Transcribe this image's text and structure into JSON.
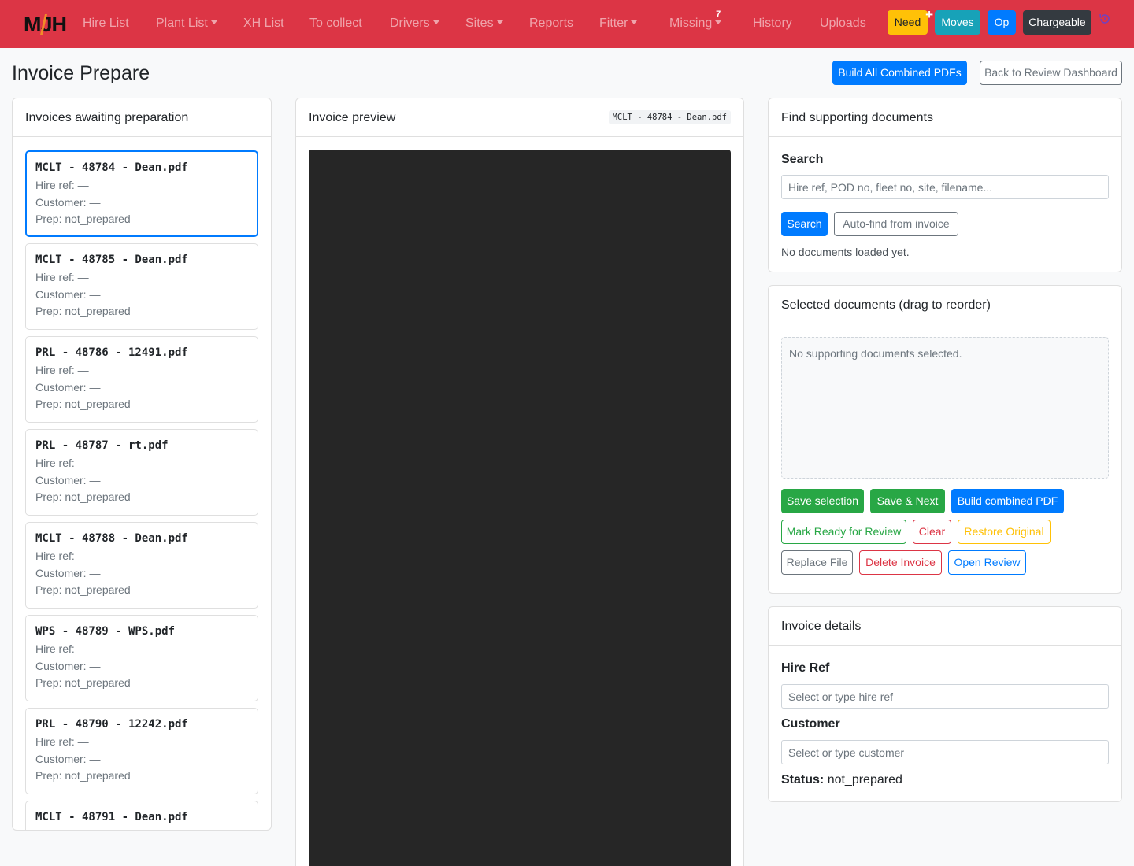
{
  "app": {
    "logo_text": "MJH",
    "nav_items": [
      {
        "label": "Hire List",
        "dropdown": false
      },
      {
        "label": "Plant List",
        "dropdown": true
      },
      {
        "label": "XH List",
        "dropdown": false
      },
      {
        "label": "To collect",
        "dropdown": false
      },
      {
        "label": "Drivers",
        "dropdown": true
      },
      {
        "label": "Sites",
        "dropdown": true
      },
      {
        "label": "Reports",
        "dropdown": false
      },
      {
        "label": "Fitter",
        "dropdown": true
      },
      {
        "label": "Missing",
        "dropdown": true,
        "badge": "7"
      },
      {
        "label": "History",
        "dropdown": false
      },
      {
        "label": "Uploads",
        "dropdown": false
      }
    ],
    "nav_buttons": {
      "need": {
        "label": "Need",
        "color": "#ffc107",
        "marker": "+"
      },
      "moves": {
        "label": "Moves",
        "color": "#17a2b8"
      },
      "op": {
        "label": "Op",
        "color": "#007bff"
      },
      "chargeable": {
        "label": "Chargeable",
        "color": "#343a40"
      }
    },
    "history_icon": "history-icon"
  },
  "page": {
    "title": "Invoice Prepare",
    "build_all_label": "Build All Combined PDFs",
    "back_label": "Back to Review Dashboard"
  },
  "invoices": {
    "header": "Invoices awaiting preparation",
    "hire_ref_label": "Hire ref: —",
    "customer_label": "Customer: —",
    "items": [
      {
        "name": "MCLT - 48784 - Dean.pdf",
        "prep": "Prep: not_prepared",
        "active": true
      },
      {
        "name": "MCLT - 48785 - Dean.pdf",
        "prep": "Prep: not_prepared"
      },
      {
        "name": "PRL - 48786 - 12491.pdf",
        "prep": "Prep: not_prepared"
      },
      {
        "name": "PRL - 48787 - rt.pdf",
        "prep": "Prep: not_prepared"
      },
      {
        "name": "MCLT - 48788 - Dean.pdf",
        "prep": "Prep: not_prepared"
      },
      {
        "name": "WPS - 48789 - WPS.pdf",
        "prep": "Prep: not_prepared"
      },
      {
        "name": "PRL - 48790 - 12242.pdf",
        "prep": "Prep: not_prepared"
      },
      {
        "name": "MCLT - 48791 - Dean.pdf",
        "prep": ""
      }
    ]
  },
  "preview": {
    "header": "Invoice preview",
    "filename": "MCLT - 48784 - Dean.pdf"
  },
  "find_docs": {
    "header": "Find supporting documents",
    "search_label": "Search",
    "search_placeholder": "Hire ref, POD no, fleet no, site, filename...",
    "search_button": "Search",
    "autofind_button": "Auto-find from invoice",
    "status": "No documents loaded yet."
  },
  "selected_docs": {
    "header": "Selected documents (drag to reorder)",
    "empty": "No supporting documents selected.",
    "buttons": {
      "save_selection": "Save selection",
      "save_next": "Save & Next",
      "build_combined": "Build combined PDF",
      "mark_ready": "Mark Ready for Review",
      "clear": "Clear",
      "restore": "Restore Original",
      "replace": "Replace File",
      "delete": "Delete Invoice",
      "open_review": "Open Review"
    }
  },
  "details": {
    "header": "Invoice details",
    "hire_ref_label": "Hire Ref",
    "hire_ref_placeholder": "Select or type hire ref",
    "customer_label": "Customer",
    "customer_placeholder": "Select or type customer",
    "status_label": "Status:",
    "status_value": "not_prepared"
  }
}
